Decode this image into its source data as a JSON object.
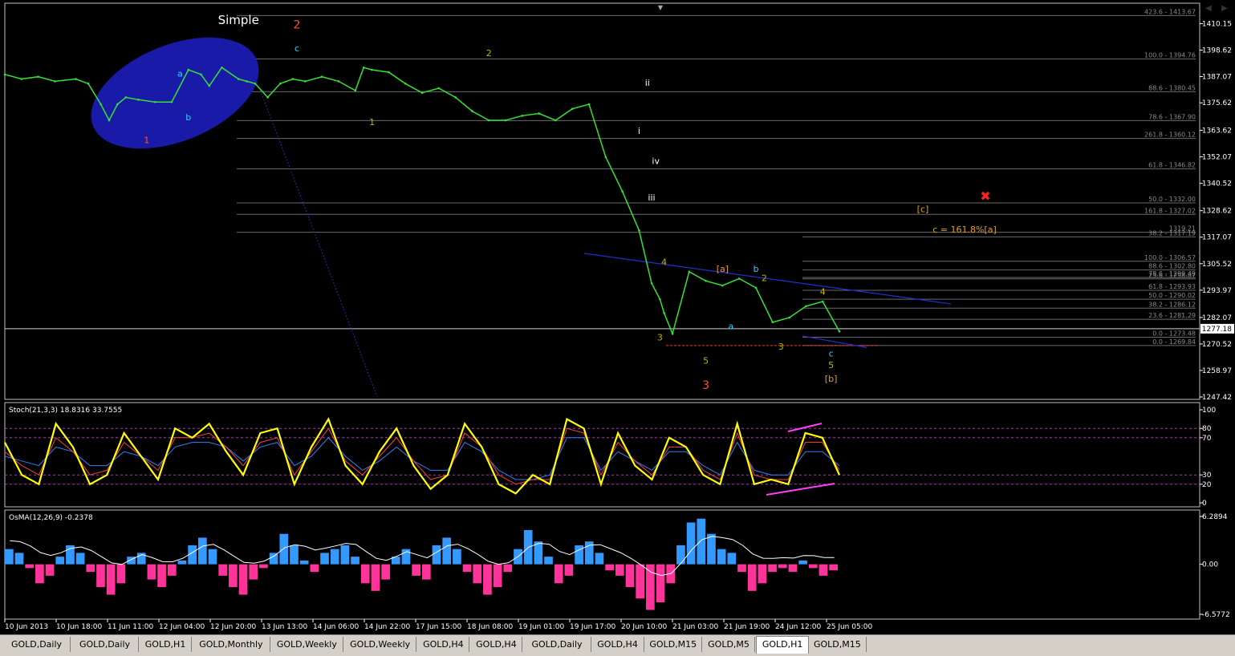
{
  "chart_data": [
    {
      "type": "line",
      "panel": "price",
      "symbol": "GOLD",
      "timeframe": "H1",
      "title": "Simple",
      "y_axis_labels": [
        "1410.15",
        "1398.62",
        "1387.07",
        "1375.62",
        "1363.62",
        "1352.07",
        "1340.52",
        "1328.62",
        "1317.07",
        "1305.52",
        "1293.97",
        "1282.07",
        "1270.52",
        "1258.97",
        "1247.42"
      ],
      "current_price": "1277.18",
      "ylim": [
        1247.42,
        1418.0
      ],
      "x_labels": [
        "10 Jun 2013",
        "10 Jun 18:00",
        "11 Jun 11:00",
        "12 Jun 04:00",
        "12 Jun 20:00",
        "13 Jun 13:00",
        "14 Jun 06:00",
        "14 Jun 22:00",
        "17 Jun 15:00",
        "18 Jun 08:00",
        "19 Jun 01:00",
        "19 Jun 17:00",
        "20 Jun 10:00",
        "21 Jun 03:00",
        "21 Jun 19:00",
        "24 Jun 12:00",
        "25 Jun 05:00"
      ],
      "series": [
        {
          "color": "#34e234",
          "x": [
            0,
            0.02,
            0.04,
            0.06,
            0.085,
            0.1,
            0.115,
            0.125,
            0.135,
            0.145,
            0.16,
            0.18,
            0.2,
            0.22,
            0.235,
            0.245,
            0.26,
            0.28,
            0.29,
            0.3,
            0.315,
            0.33,
            0.345,
            0.36,
            0.38,
            0.4,
            0.42,
            0.43,
            0.44,
            0.46,
            0.48,
            0.5,
            0.52,
            0.54,
            0.56,
            0.58,
            0.6,
            0.62,
            0.64,
            0.66,
            0.68,
            0.7,
            0.72,
            0.74,
            0.76,
            0.775,
            0.785,
            0.79,
            0.8,
            0.82,
            0.84,
            0.86,
            0.88,
            0.9,
            0.92,
            0.94,
            0.96,
            0.98,
            1.0
          ],
          "values": [
            1388,
            1386,
            1387,
            1385,
            1386,
            1384,
            1375,
            1368,
            1375,
            1378,
            1377,
            1376,
            1376,
            1390,
            1388,
            1383,
            1391,
            1386,
            1385,
            1384,
            1378,
            1384,
            1386,
            1385,
            1387,
            1385,
            1381,
            1391,
            1390,
            1389,
            1384,
            1380,
            1382,
            1378,
            1372,
            1368,
            1368,
            1370,
            1371,
            1368,
            1373,
            1375,
            1352,
            1337,
            1320,
            1297,
            1290,
            1284,
            1275,
            1302,
            1298,
            1296,
            1299,
            1295,
            1280,
            1282,
            1287,
            1289,
            1276
          ]
        }
      ],
      "annotations": [
        {
          "text": "2",
          "color": "#ff5030",
          "x": 0.35,
          "y": 1408
        },
        {
          "text": "c",
          "color": "#33ccff",
          "x": 0.35,
          "y": 1398
        },
        {
          "text": "a",
          "color": "#33ccff",
          "x": 0.21,
          "y": 1387
        },
        {
          "text": "b",
          "color": "#33ccff",
          "x": 0.22,
          "y": 1368
        },
        {
          "text": "1",
          "color": "#ff5030",
          "x": 0.17,
          "y": 1358
        },
        {
          "text": "2",
          "color": "#b8b800",
          "x": 0.58,
          "y": 1396
        },
        {
          "text": "1",
          "color": "#b8b800",
          "x": 0.44,
          "y": 1366
        },
        {
          "text": "ii",
          "color": "#ffffff",
          "x": 0.77,
          "y": 1383
        },
        {
          "text": "i",
          "color": "#ffffff",
          "x": 0.76,
          "y": 1362
        },
        {
          "text": "iv",
          "color": "#ffffff",
          "x": 0.78,
          "y": 1349
        },
        {
          "text": "iii",
          "color": "#ffffff",
          "x": 0.775,
          "y": 1333
        },
        {
          "text": "4",
          "color": "#b8b800",
          "x": 0.79,
          "y": 1305
        },
        {
          "text": "[a]",
          "color": "#e6a020",
          "x": 0.86,
          "y": 1302
        },
        {
          "text": "b",
          "color": "#33ccff",
          "x": 0.9,
          "y": 1302
        },
        {
          "text": "2",
          "color": "#b8b800",
          "x": 0.91,
          "y": 1298
        },
        {
          "text": "4",
          "color": "#b8b800",
          "x": 0.98,
          "y": 1292
        },
        {
          "text": "3",
          "color": "#b8b800",
          "x": 0.785,
          "y": 1272
        },
        {
          "text": "a",
          "color": "#33ccff",
          "x": 0.87,
          "y": 1277
        },
        {
          "text": "5",
          "color": "#b8b800",
          "x": 0.84,
          "y": 1262
        },
        {
          "text": "3",
          "color": "#ff5030",
          "x": 0.84,
          "y": 1251
        },
        {
          "text": "3",
          "color": "#b8b800",
          "x": 0.93,
          "y": 1268
        },
        {
          "text": "c",
          "color": "#33ccff",
          "x": 0.99,
          "y": 1265
        },
        {
          "text": "5",
          "color": "#b8b800",
          "x": 0.99,
          "y": 1260
        },
        {
          "text": "[b]",
          "color": "#e6a020",
          "x": 0.99,
          "y": 1254
        },
        {
          "text": "[c]",
          "color": "#e6a020",
          "x": 1.1,
          "y": 1328
        },
        {
          "text": "c = 161.8%[a]",
          "color": "#e6a020",
          "x": 1.15,
          "y": 1319
        }
      ],
      "fib_levels": [
        {
          "label": "423.6 - 1413.67",
          "value": 1413.67
        },
        {
          "label": "100.0 - 1394.76",
          "value": 1394.76
        },
        {
          "label": "88.6 - 1380.45",
          "value": 1380.45
        },
        {
          "label": "78.6 - 1367.90",
          "value": 1367.9
        },
        {
          "label": "261.8 - 1360.12",
          "value": 1360.12
        },
        {
          "label": "61.8 - 1346.82",
          "value": 1346.82
        },
        {
          "label": "50.0 - 1332.00",
          "value": 1332.0
        },
        {
          "label": "161.8 - 1327.02",
          "value": 1327.02
        },
        {
          "label": "1319.21",
          "value": 1319.21
        },
        {
          "label": "38.2 - 1317.19",
          "value": 1317.19
        },
        {
          "label": "100.0 - 1306.57",
          "value": 1306.57
        },
        {
          "label": "88.6 - 1302.80",
          "value": 1302.8
        },
        {
          "label": "78.6 - 1299.49",
          "value": 1299.49
        },
        {
          "label": "23.6 - 1298.87",
          "value": 1298.87
        },
        {
          "label": "61.8 - 1293.93",
          "value": 1293.93
        },
        {
          "label": "50.0 - 1290.02",
          "value": 1290.02
        },
        {
          "label": "38.2 - 1286.12",
          "value": 1286.12
        },
        {
          "label": "23.6 - 1281.29",
          "value": 1281.29
        },
        {
          "label": "0.0 - 1273.48",
          "value": 1273.48
        },
        {
          "label": "0.0 - 1269.84",
          "value": 1269.84
        }
      ]
    },
    {
      "type": "line",
      "panel": "stochastic",
      "title": "Stoch(21,3,3) 18.8316 33.7555",
      "y_axis_labels": [
        "100",
        "80",
        "70",
        "30",
        "20",
        "0"
      ],
      "ylim": [
        0,
        100
      ],
      "series": [
        {
          "name": "Stoch main",
          "color": "#ffff00",
          "values": [
            65,
            30,
            20,
            85,
            60,
            20,
            30,
            75,
            50,
            25,
            80,
            70,
            85,
            55,
            30,
            75,
            80,
            20,
            60,
            90,
            40,
            20,
            55,
            80,
            40,
            15,
            30,
            85,
            60,
            20,
            10,
            30,
            20,
            90,
            80,
            20,
            75,
            40,
            25,
            70,
            60,
            30,
            20,
            85,
            20,
            25,
            20,
            75,
            70,
            30
          ]
        },
        {
          "name": "Signal",
          "color": "#ff4040",
          "values": [
            55,
            40,
            30,
            70,
            55,
            30,
            35,
            65,
            50,
            35,
            70,
            70,
            75,
            60,
            40,
            65,
            70,
            30,
            55,
            80,
            45,
            30,
            50,
            70,
            45,
            25,
            30,
            75,
            60,
            30,
            20,
            25,
            25,
            80,
            75,
            30,
            65,
            45,
            30,
            60,
            60,
            35,
            25,
            75,
            30,
            25,
            25,
            65,
            65,
            35
          ]
        },
        {
          "name": "Stoch slow",
          "color": "#3080ff",
          "values": [
            50,
            45,
            40,
            60,
            55,
            40,
            40,
            55,
            50,
            40,
            60,
            65,
            65,
            60,
            45,
            60,
            65,
            40,
            50,
            70,
            50,
            35,
            45,
            60,
            45,
            35,
            35,
            65,
            55,
            35,
            25,
            25,
            30,
            70,
            70,
            35,
            55,
            45,
            35,
            55,
            55,
            40,
            30,
            65,
            35,
            30,
            30,
            55,
            55,
            40
          ]
        }
      ],
      "levels": [
        80,
        70,
        30,
        20
      ]
    },
    {
      "type": "bar",
      "panel": "osma",
      "title": "OsMA(12,26,9) -0.2378",
      "y_axis_labels": [
        "6.2894",
        "0.00",
        "-6.5772"
      ],
      "ylim": [
        -6.5772,
        6.2894
      ],
      "values": [
        2.0,
        1.5,
        -0.5,
        -2.5,
        -1.5,
        1.0,
        2.5,
        1.5,
        -1.0,
        -3.0,
        -4.0,
        -2.5,
        1.0,
        1.5,
        -2.0,
        -3.0,
        -1.5,
        0.5,
        2.5,
        3.5,
        2.0,
        -1.5,
        -3.0,
        -4.0,
        -2.0,
        -0.5,
        1.5,
        4.0,
        2.5,
        0.5,
        -1.0,
        1.5,
        2.0,
        2.5,
        1.0,
        -2.5,
        -3.5,
        -2.0,
        1.0,
        2.0,
        -1.5,
        -2.0,
        2.5,
        3.5,
        2.0,
        -1.0,
        -2.5,
        -4.0,
        -3.0,
        -1.0,
        2.0,
        4.5,
        3.0,
        1.0,
        -2.5,
        -1.5,
        2.5,
        3.0,
        1.5,
        -0.8,
        -1.5,
        -3.0,
        -4.5,
        -6.0,
        -5.0,
        -2.5,
        2.5,
        5.5,
        6.0,
        4.0,
        2.0,
        1.5,
        -1.0,
        -3.5,
        -2.5,
        -1.0,
        -0.5,
        -1.0,
        0.5,
        -0.5,
        -1.5,
        -0.8
      ]
    }
  ],
  "tabs": [
    "GOLD,Daily",
    "GOLD,Daily",
    "GOLD,H1",
    "GOLD,Monthly",
    "GOLD,Weekly",
    "GOLD,Weekly",
    "GOLD,H4",
    "GOLD,H4",
    "GOLD,Daily",
    "GOLD,H4",
    "GOLD,M15",
    "GOLD,M5",
    "GOLD,H1",
    "GOLD,M15"
  ],
  "active_tab": 12,
  "colors": {
    "bg": "#000000",
    "grid": "#3a3a3a",
    "up": "#34e234",
    "axis": "#ffffff",
    "histo_pos": "#3399ff",
    "histo_neg": "#ff3399"
  }
}
